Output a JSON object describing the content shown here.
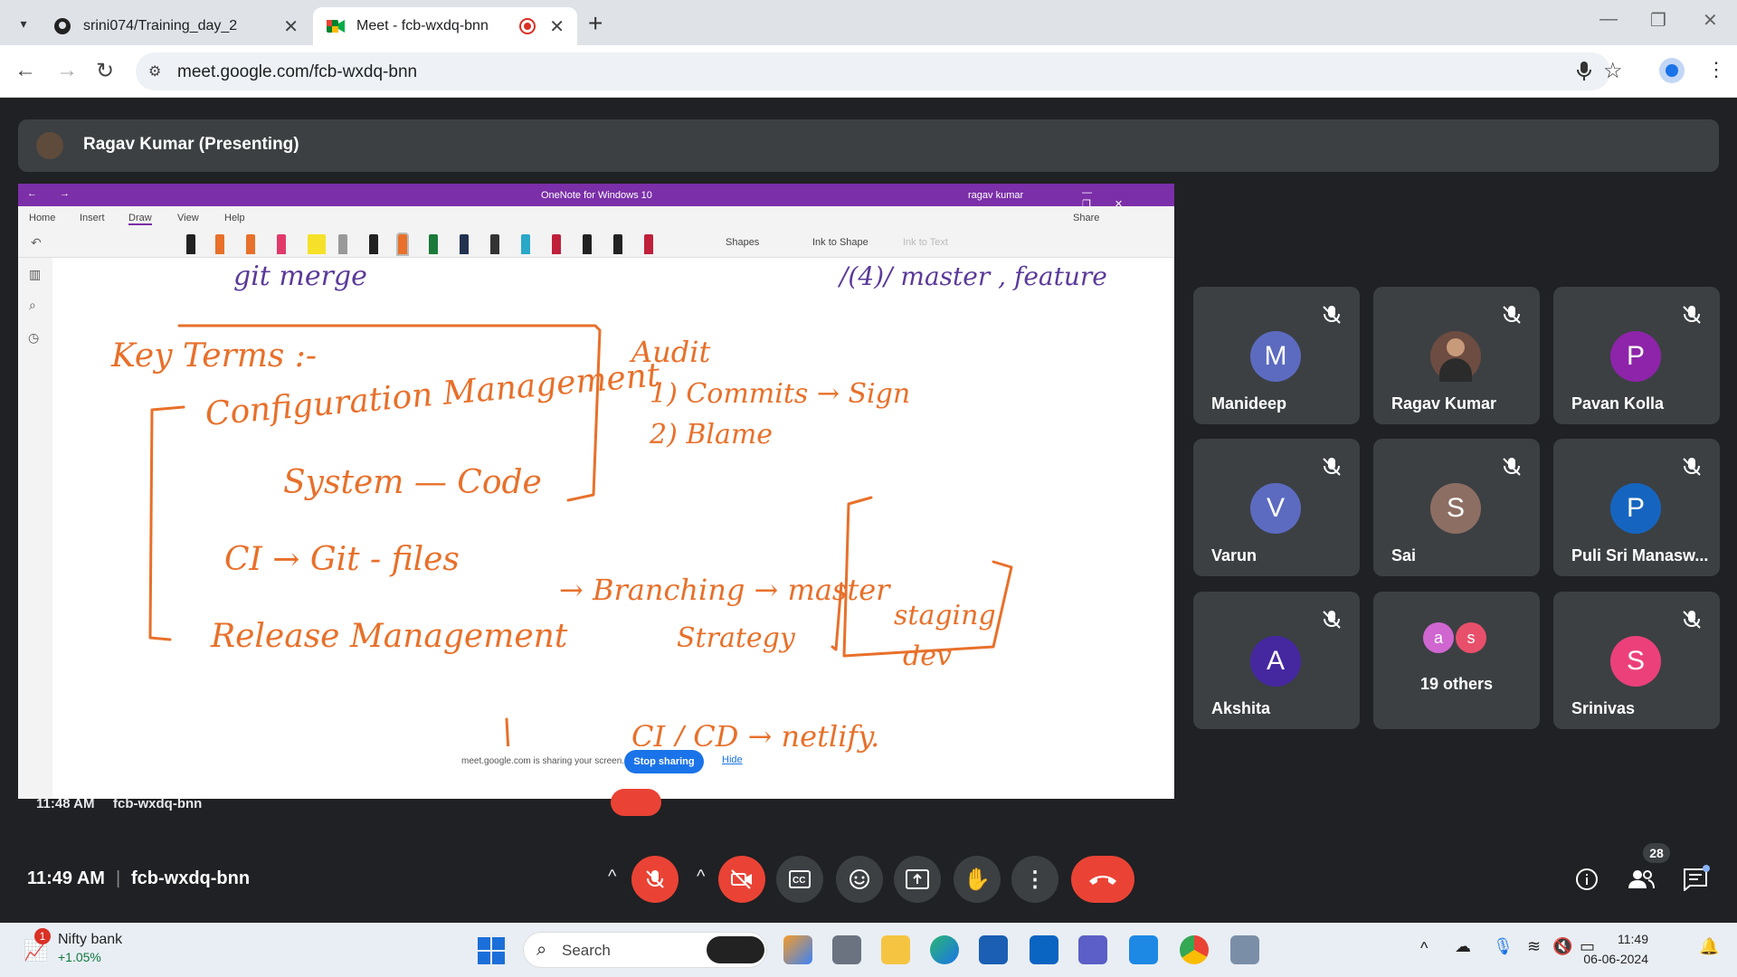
{
  "browser": {
    "tabs": [
      {
        "title": "srini074/Training_day_2",
        "active": false
      },
      {
        "title": "Meet - fcb-wxdq-bnn",
        "active": true
      }
    ],
    "url": "meet.google.com/fcb-wxdq-bnn"
  },
  "meet": {
    "presenter_label": "Ragav Kumar (Presenting)",
    "shared_window": {
      "title": "OneNote for Windows 10",
      "user": "ragav kumar",
      "menu": [
        "Home",
        "Insert",
        "Draw",
        "View",
        "Help"
      ],
      "share_label": "Share",
      "shapes_label": "Shapes",
      "ink_to_shape_label": "Ink to Shape",
      "ink_to_text_label": "Ink to Text",
      "sharing_notice": "meet.google.com is sharing your screen.",
      "stop_sharing": "Stop sharing",
      "hide": "Hide",
      "inner_time": "11:48 AM",
      "inner_code": "fcb-wxdq-bnn"
    },
    "participants": [
      {
        "name": "Manideep",
        "initial": "M",
        "color": "#5c6bc0",
        "muted": true
      },
      {
        "name": "Ragav Kumar",
        "initial": "",
        "color": "#6d4c41",
        "muted": true,
        "photo": true
      },
      {
        "name": "Pavan Kolla",
        "initial": "P",
        "color": "#8e24aa",
        "muted": true
      },
      {
        "name": "Varun",
        "initial": "V",
        "color": "#5c6bc0",
        "muted": true
      },
      {
        "name": "Sai",
        "initial": "S",
        "color": "#8d6e63",
        "muted": true
      },
      {
        "name": "Puli Sri Manasw...",
        "initial": "P",
        "color": "#1565c0",
        "muted": true
      },
      {
        "name": "Akshita",
        "initial": "A",
        "color": "#4527a0",
        "muted": true
      },
      {
        "name": "19 others",
        "initial": "",
        "color": "#3c4043",
        "muted": false,
        "others": [
          "a",
          "s"
        ]
      },
      {
        "name": "Srinivas",
        "initial": "S",
        "color": "#ec407a",
        "muted": true
      }
    ],
    "time": "11:49 AM",
    "meeting_code": "fcb-wxdq-bnn",
    "people_count": "28",
    "controls": [
      "chevron-up-icon",
      "mic-off-icon",
      "chevron-up-icon",
      "camera-off-icon",
      "captions-icon",
      "emoji-icon",
      "present-icon",
      "raise-hand-icon",
      "more-icon",
      "end-call-icon"
    ]
  },
  "taskbar": {
    "widget_label": "Nifty bank",
    "widget_value": "+1.05%",
    "widget_badge": "1",
    "search_label": "Search",
    "time": "11:49",
    "date": "06-06-2024"
  },
  "whiteboard_ink": [
    "git merge",
    "/(4)/ master , feature",
    "Key Terms :-",
    "Configuration Management",
    "System — Code",
    "CI → Git - files",
    "Release Management",
    "Audit",
    "1) Commits → Sign",
    "2) Blame",
    "→ Branching → master",
    "Strategy",
    "staging",
    "dev",
    "CI / CD → netlify."
  ]
}
